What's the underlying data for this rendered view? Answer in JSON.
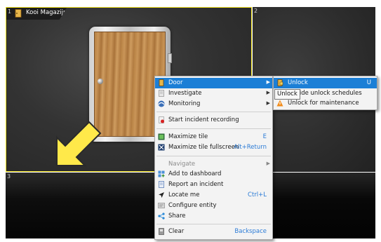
{
  "tiles": [
    {
      "number": "1",
      "title": "Kooi Magazijn"
    },
    {
      "number": "2"
    },
    {
      "number": "3"
    }
  ],
  "context_menu": {
    "items": [
      {
        "label": "Door",
        "icon": "door-icon",
        "submenu": true,
        "selected": true
      },
      {
        "label": "Investigate",
        "icon": "document-icon",
        "submenu": true
      },
      {
        "label": "Monitoring",
        "icon": "monitoring-icon",
        "submenu": true
      },
      {
        "label": "Start incident recording",
        "icon": "record-icon"
      },
      {
        "label": "Maximize tile",
        "icon": "maximize-icon",
        "shortcut": "E"
      },
      {
        "label": "Maximize tile fullscreen",
        "icon": "fullscreen-icon",
        "shortcut": "Alt+Return"
      },
      {
        "label": "Navigate",
        "submenu": true,
        "disabled": true
      },
      {
        "label": "Add to dashboard",
        "icon": "dashboard-icon"
      },
      {
        "label": "Report an incident",
        "icon": "report-icon"
      },
      {
        "label": "Locate me",
        "icon": "locate-icon",
        "shortcut": "Ctrl+L"
      },
      {
        "label": "Configure entity",
        "icon": "configure-icon"
      },
      {
        "label": "Share",
        "icon": "share-icon"
      },
      {
        "label": "Clear",
        "icon": "clear-icon",
        "shortcut": "Backspace"
      }
    ]
  },
  "door_submenu": {
    "items": [
      {
        "label": "Unlock",
        "icon": "unlock-icon",
        "shortcut": "U",
        "selected": true
      },
      {
        "label": "rride unlock schedules"
      },
      {
        "label": "Unlock for maintenance",
        "icon": "maintenance-icon"
      }
    ]
  },
  "tooltip": "Unlock",
  "colors": {
    "selection": "#1c7fd6",
    "tile_border": "#f0e11e",
    "shortcut": "#2b7bd6",
    "arrow": "#ffe94a"
  }
}
